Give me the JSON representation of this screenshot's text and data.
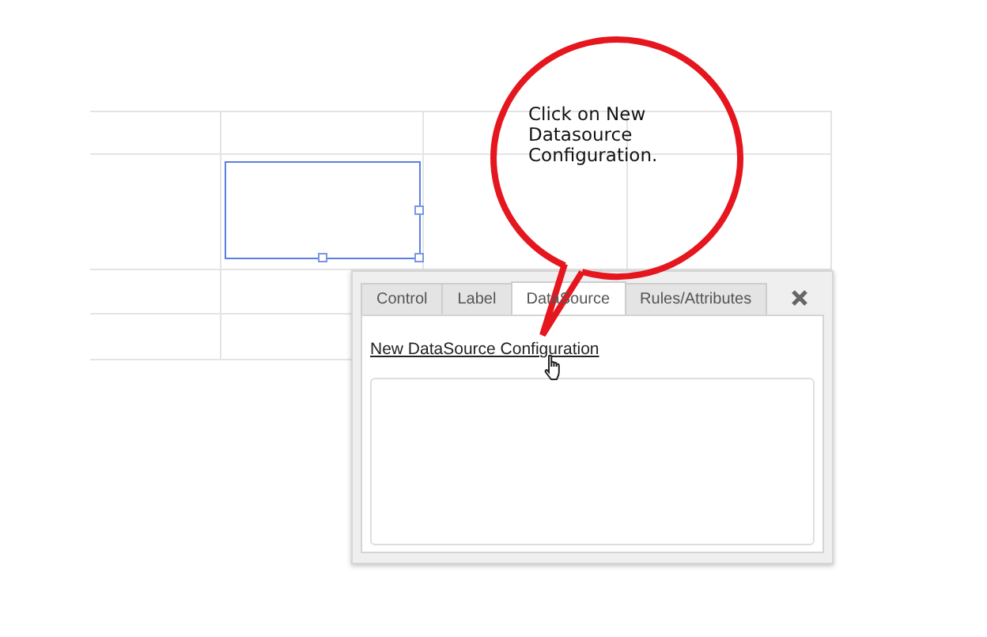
{
  "canvas": {
    "control": {
      "selected": true
    }
  },
  "callout": {
    "text": "Click on New Datasource Configuration."
  },
  "panel": {
    "tabs": [
      {
        "label": "Control",
        "selected": false
      },
      {
        "label": "Label",
        "selected": false
      },
      {
        "label": "DataSource",
        "selected": true
      },
      {
        "label": "Rules/Attributes",
        "selected": false
      }
    ],
    "link": "New DataSource Configuration"
  }
}
